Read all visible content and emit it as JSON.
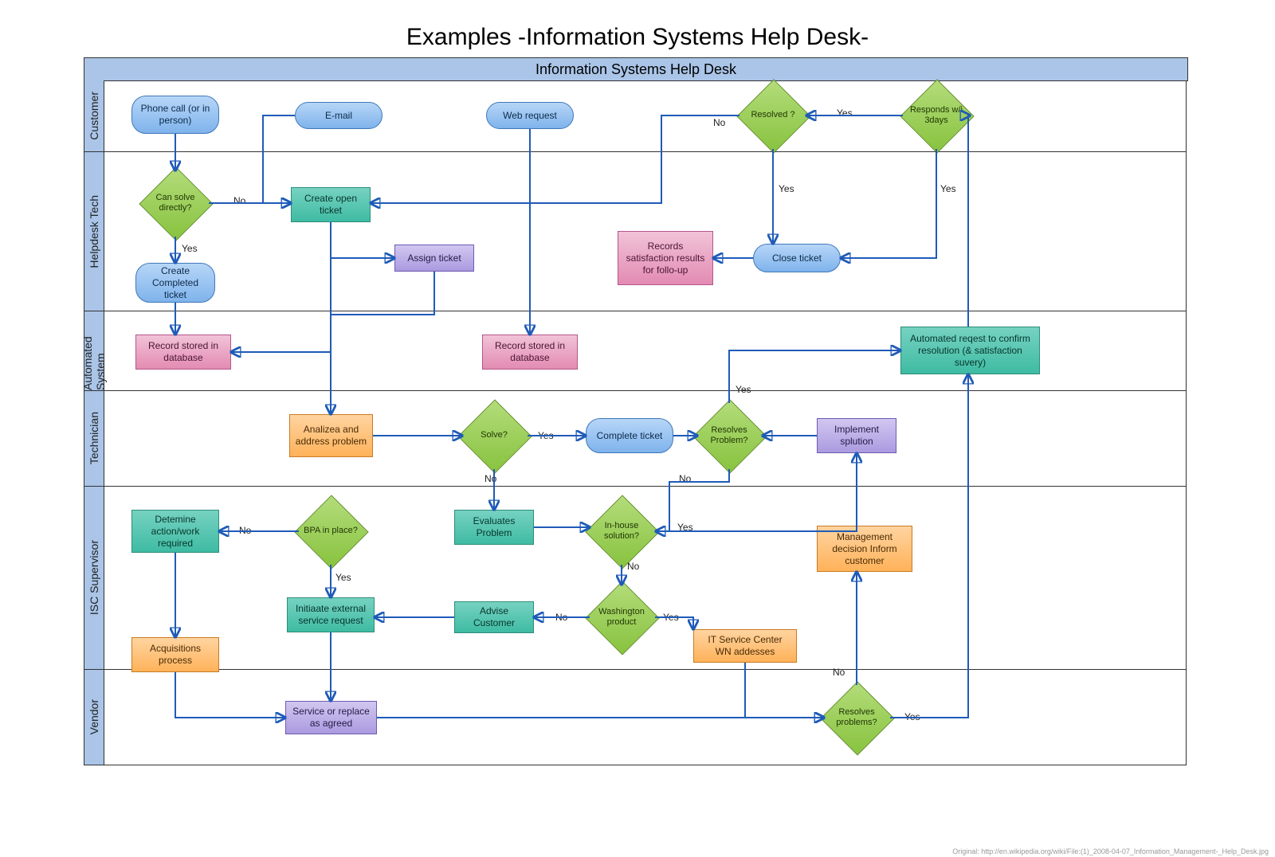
{
  "title": "Examples -Information Systems Help Desk-",
  "pool": "Information Systems Help Desk",
  "lanes": {
    "customer": "Customer",
    "helpdesk": "Helpdesk Tech",
    "automated": "Automated System",
    "technician": "Technician",
    "supervisor": "ISC Supervisor",
    "vendor": "Vendor"
  },
  "nodes": {
    "phone": "Phone call (or in person)",
    "email": "E-mail",
    "web": "Web request",
    "resolved": "Resolved ?",
    "responds": "Responds w/i 3days",
    "can_solve": "Can solve directly?",
    "create_open": "Create open ticket",
    "assign": "Assign ticket",
    "records_followup": "Records satisfaction results for follo-up",
    "close_ticket": "Close ticket",
    "create_completed": "Create Completed ticket",
    "record_db1": "Record stored in database",
    "record_db2": "Record stored in database",
    "auto_request": "Automated reqest to confirm resolution (& satisfaction suvery)",
    "analyze": "Analizea and address problem",
    "solve": "Solve?",
    "complete_ticket": "Complete ticket",
    "resolves_problem": "Resolves Problem?",
    "implement": "Implement splution",
    "determine": "Detemine action/work required",
    "bpa": "BPA in place?",
    "evaluates": "Evaluates Problem",
    "inhouse": "In-house solution?",
    "mgmt": "Management decision Inform customer",
    "initiate_ext": "Initiaate external service request",
    "advise": "Advise Customer",
    "washington": "Washington product",
    "it_center": "IT Service Center WN addesses",
    "acquisitions": "Acquisitions process",
    "service_replace": "Service or replace as agreed",
    "resolves_problems2": "Resolves problems?"
  },
  "labels": {
    "yes": "Yes",
    "no": "No"
  },
  "credit": "Original: http://en.wikipedia.org/wiki/File:(1)_2008-04-07_Information_Management-_Help_Desk.jpg"
}
